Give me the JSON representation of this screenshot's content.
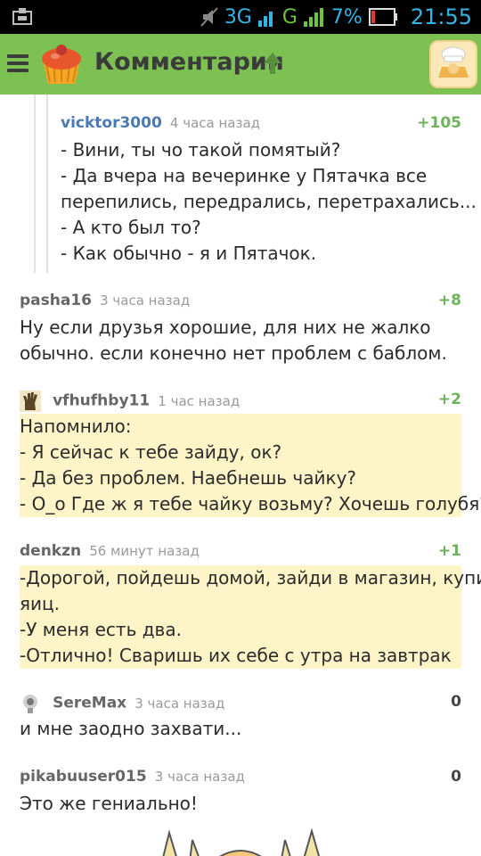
{
  "status": {
    "network": "3G",
    "network2": "G",
    "battery": "7%",
    "time": "21:55"
  },
  "header": {
    "title": "Комментарии"
  },
  "comments": [
    {
      "author": "vicktor3000",
      "time": "4 часа назад",
      "rating": "+105",
      "lines": [
        "- Вини, ты чо такой помятый?",
        "- Да вчера на вечеринке у Пятачка все",
        "перепились, передрались, перетрахались...",
        "- А кто был то?",
        "- Как обычно - я и Пятачок."
      ]
    },
    {
      "author": "pasha16",
      "time": "3 часа назад",
      "rating": "+8",
      "lines": [
        "Ну если друзья хорошие, для них не жалко",
        "обычно. если конечно нет проблем с баблом."
      ]
    },
    {
      "author": "vfhufhby11",
      "time": "1 час назад",
      "rating": "+2",
      "lines": [
        "Напомнило:",
        "- Я сейчас к тебе зайду, ок?",
        "- Да без проблем. Наебнешь чайку?",
        "- О_о Где ж я тебе чайку возьму? Хочешь голубя?"
      ]
    },
    {
      "author": "denkzn",
      "time": "56 минут назад",
      "rating": "+1",
      "lines": [
        "-Дорогой, пойдешь домой, зайди в магазин, купи",
        "яиц.",
        "-У меня есть два.",
        "-Отлично! Сваришь их себе с утра на завтрак"
      ]
    },
    {
      "author": "SereMax",
      "time": "3 часа назад",
      "rating": "0",
      "lines": [
        "и мне заодно захвати..."
      ]
    },
    {
      "author": "pikabuuser015",
      "time": "3 часа назад",
      "rating": "0",
      "lines": [
        "Это же гениально!"
      ]
    }
  ]
}
